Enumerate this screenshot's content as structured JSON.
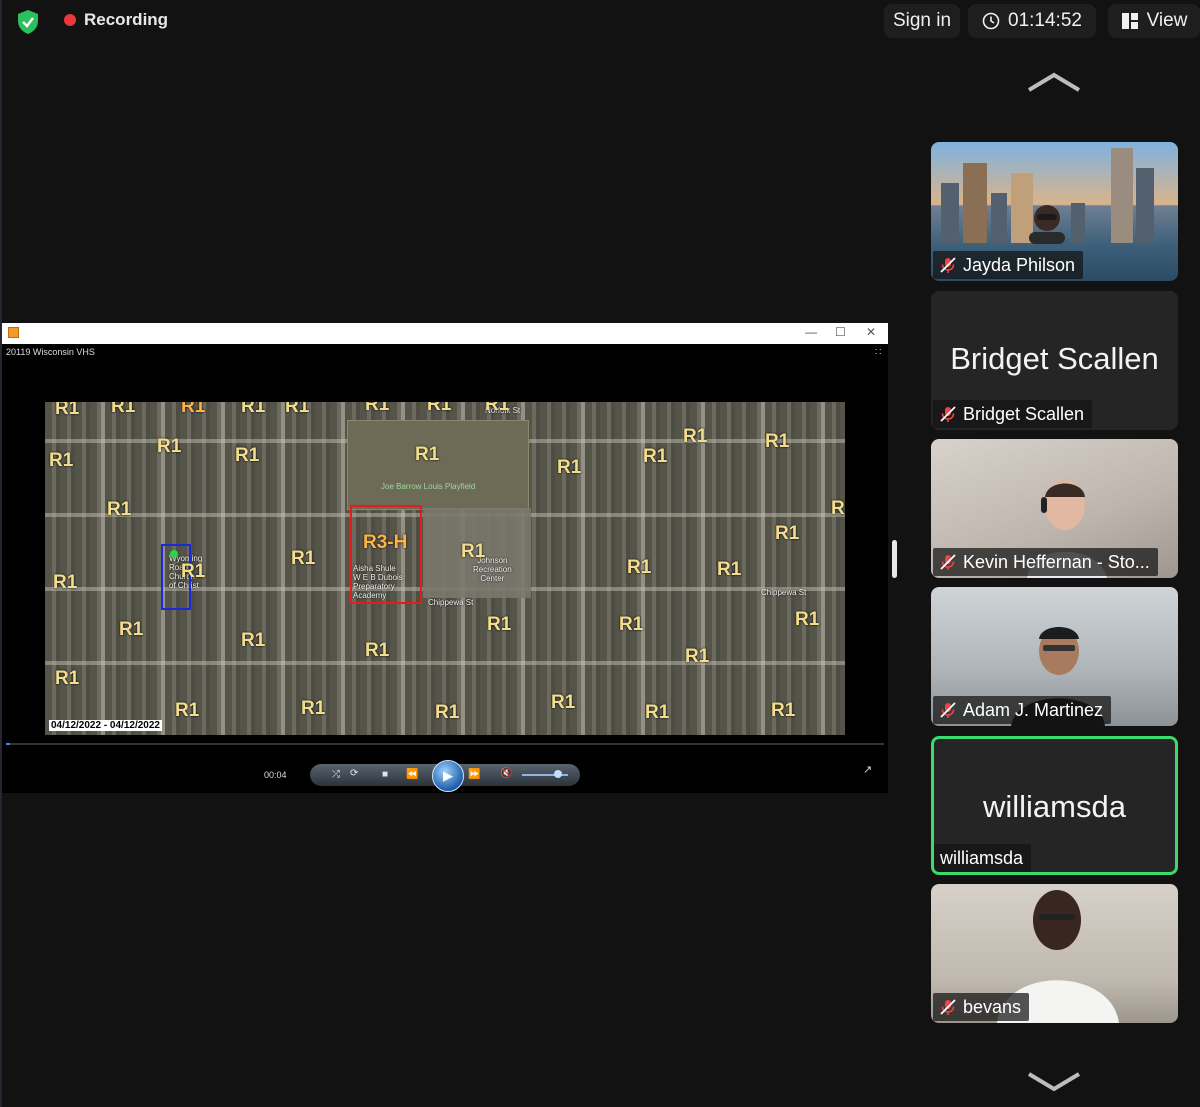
{
  "topbar": {
    "recording_label": "Recording",
    "signin_label": "Sign in",
    "timer": "01:14:52",
    "view_label": "View"
  },
  "share": {
    "window_title": "20119 Wisconsin VHS",
    "map": {
      "labels": [
        "R1",
        "R3-H"
      ],
      "place_names": {
        "playfield": "Joe Barrow Louis Playfield",
        "academy": "Aisha Shule\nW E B Dubois\nPreparatory\nAcademy",
        "recreation": "Johnson\nRecreation\nCenter",
        "church": "Wyoming\nRoad\nChurch\nof Christ",
        "street_norfolk": "Norfolk St",
        "street_chippewa": "Chippewa St"
      },
      "date_range": "04/12/2022 - 04/12/2022"
    },
    "player": {
      "elapsed": "00:04",
      "progress_fraction": 0.005,
      "buttons": [
        "shuffle",
        "repeat",
        "stop",
        "previous",
        "play",
        "next",
        "mute"
      ]
    }
  },
  "participants": [
    {
      "name": "Jayda Philson",
      "muted": true,
      "video": true
    },
    {
      "name": "Bridget Scallen",
      "display_name": "Bridget Scallen",
      "muted": true,
      "video": false
    },
    {
      "name": "Kevin Heffernan - Sto...",
      "muted": true,
      "video": true
    },
    {
      "name": "Adam J. Martinez",
      "muted": true,
      "video": true
    },
    {
      "name": "williamsda",
      "display_name": "williamsda",
      "muted": false,
      "video": false,
      "active_speaker": true
    },
    {
      "name": "bevans",
      "muted": true,
      "video": true
    }
  ],
  "colors": {
    "background": "#121212",
    "recording_dot": "#e8393b",
    "active_speaker_border": "#3cd96b",
    "shield": "#2bbf5d"
  },
  "icons": [
    "shield-icon",
    "recording-dot-icon",
    "clock-icon",
    "view-grid-icon",
    "chevron-up-icon",
    "chevron-down-icon",
    "mic-muted-icon"
  ]
}
